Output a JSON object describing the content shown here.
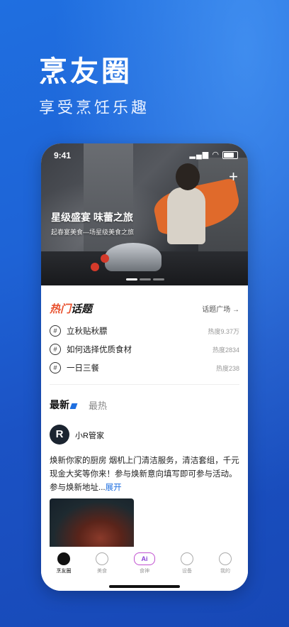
{
  "promo": {
    "title": "烹友圈",
    "subtitle": "享受烹饪乐趣"
  },
  "status": {
    "time": "9:41"
  },
  "hero": {
    "title": "星级盛宴  味蕾之旅",
    "subtitle": "起春宴美食—场星级美食之旅"
  },
  "topics": {
    "title_hot": "热门",
    "title_rest": "话题",
    "more": "话题广场 →",
    "items": [
      {
        "name": "立秋贴秋膘",
        "heat": "热度9.37万"
      },
      {
        "name": "如何选择优质食材",
        "heat": "热度2834"
      },
      {
        "name": "一日三餐",
        "heat": "热度238"
      }
    ]
  },
  "feed_tabs": {
    "latest": "最新",
    "hot": "最热"
  },
  "post": {
    "avatar_letter": "R",
    "author": "小R管家",
    "text": "焕新你家的厨房  烟机上门清洁服务，清洁套组，千元现金大奖等你来！参与焕新意向填写即可参与活动。参与焕新地址...",
    "more": "展开"
  },
  "tabbar": {
    "items": [
      {
        "label": "烹友圈",
        "icon": "home-icon"
      },
      {
        "label": "美食",
        "icon": "chef-hat-icon"
      },
      {
        "label": "食神",
        "icon": "ai-icon",
        "badge": "Ai"
      },
      {
        "label": "设备",
        "icon": "device-icon"
      },
      {
        "label": "我的",
        "icon": "profile-icon"
      }
    ]
  },
  "colors": {
    "brand_blue": "#1f6fe0",
    "accent_orange": "#e8502d"
  }
}
